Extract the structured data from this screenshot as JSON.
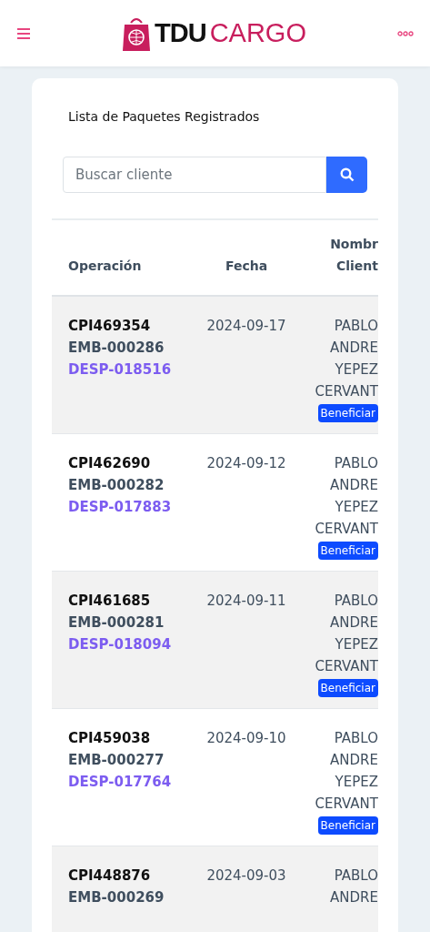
{
  "header": {
    "logo_bold": "TDU",
    "logo_light": "CARGO"
  },
  "card": {
    "title": "Lista de Paquetes Registrados"
  },
  "search": {
    "placeholder": "Buscar cliente"
  },
  "table": {
    "columns": [
      {
        "lines": [
          "Operación"
        ]
      },
      {
        "lines": [
          "Fecha"
        ]
      },
      {
        "lines": [
          "Nombr",
          "Client"
        ]
      }
    ],
    "rows": [
      {
        "operation": "CPI469354",
        "shipment": "EMB-000286",
        "dispatch": "DESP-018516",
        "date": "2024-09-17",
        "name_lines": [
          "PABLO",
          "ANDRE",
          "YEPEZ",
          "CERVANT"
        ],
        "badge": "Beneficiar",
        "shaded": true
      },
      {
        "operation": "CPI462690",
        "shipment": "EMB-000282",
        "dispatch": "DESP-017883",
        "date": "2024-09-12",
        "name_lines": [
          "PABLO",
          "ANDRE",
          "YEPEZ",
          "CERVANT"
        ],
        "badge": "Beneficiar",
        "shaded": false
      },
      {
        "operation": "CPI461685",
        "shipment": "EMB-000281",
        "dispatch": "DESP-018094",
        "date": "2024-09-11",
        "name_lines": [
          "PABLO",
          "ANDRE",
          "YEPEZ",
          "CERVANT"
        ],
        "badge": "Beneficiar",
        "shaded": true
      },
      {
        "operation": "CPI459038",
        "shipment": "EMB-000277",
        "dispatch": "DESP-017764",
        "date": "2024-09-10",
        "name_lines": [
          "PABLO",
          "ANDRE",
          "YEPEZ",
          "CERVANT"
        ],
        "badge": "Beneficiar",
        "shaded": false
      },
      {
        "operation": "CPI448876",
        "shipment": "EMB-000269",
        "date": "2024-09-03",
        "name_lines": [
          "PABLO",
          "ANDRE"
        ],
        "shaded": true
      }
    ]
  }
}
